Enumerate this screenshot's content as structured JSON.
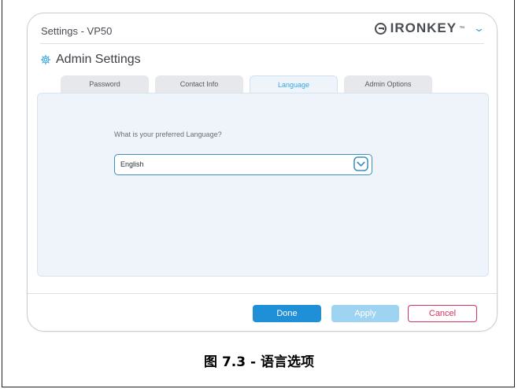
{
  "window": {
    "title": "Settings - VP50",
    "brand": "IRONKEY",
    "brand_tm": "™"
  },
  "section": {
    "title": "Admin Settings"
  },
  "tabs": [
    {
      "label": "Password",
      "active": false
    },
    {
      "label": "Contact Info",
      "active": false
    },
    {
      "label": "Language",
      "active": true
    },
    {
      "label": "Admin Options",
      "active": false
    }
  ],
  "language": {
    "question": "What is your preferred Language?",
    "selected": "English"
  },
  "buttons": {
    "done": "Done",
    "apply": "Apply",
    "cancel": "Cancel"
  },
  "caption": "图 7.3 - 语言选项",
  "colors": {
    "accent": "#1f8fd8",
    "apply_disabled": "#9fd3f2",
    "cancel": "#d2335f",
    "panel": "#eef4fa"
  },
  "icons": {
    "brand_logo": "ironkey-logo-icon",
    "brand_menu": "chevron-down-icon",
    "section": "gear-icon",
    "select": "chevron-down-circle-icon"
  }
}
